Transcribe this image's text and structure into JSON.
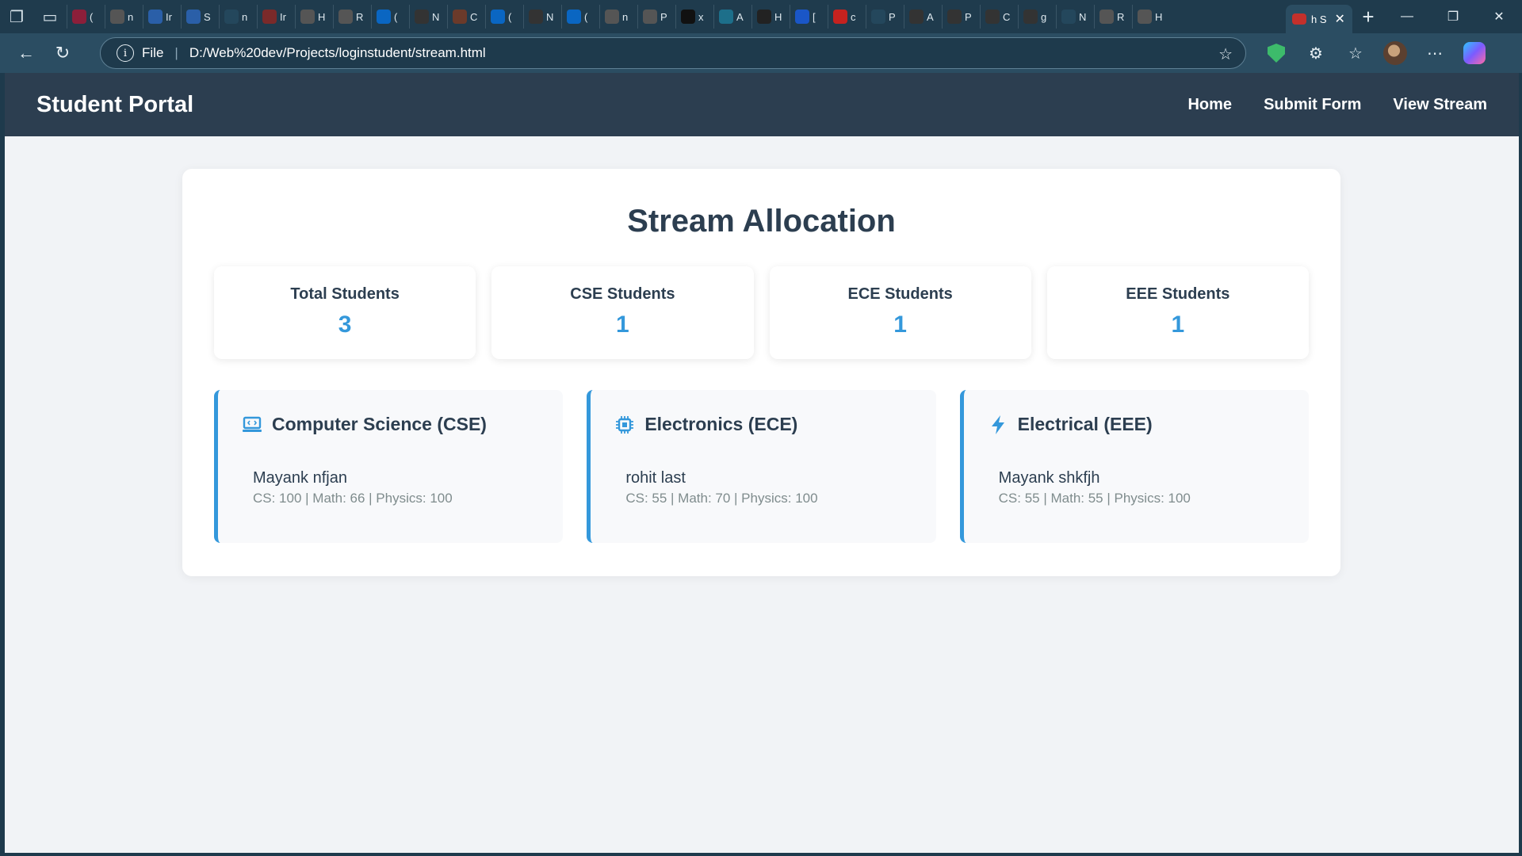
{
  "browser": {
    "url_scheme": "File",
    "url": "D:/Web%20dev/Projects/loginstudent/stream.html",
    "tab_letters": [
      "(",
      "n",
      "Ir",
      "S",
      "n",
      "Ir",
      "H",
      "R",
      "(",
      "N",
      "C",
      "(",
      "N",
      "(",
      "n",
      "P",
      "x",
      "A",
      "H",
      "[",
      "c",
      "P",
      "A",
      "P",
      "C",
      "g",
      "N",
      "R",
      "H"
    ],
    "active_tab_letter": "h S",
    "colors": {
      "tabbar": "#1f3b4d",
      "toolbar": "#2b4d62"
    }
  },
  "site": {
    "brand": "Student Portal",
    "nav": [
      "Home",
      "Submit Form",
      "View Stream"
    ]
  },
  "page": {
    "title": "Stream Allocation",
    "stats": [
      {
        "label": "Total Students",
        "value": "3"
      },
      {
        "label": "CSE Students",
        "value": "1"
      },
      {
        "label": "ECE Students",
        "value": "1"
      },
      {
        "label": "EEE Students",
        "value": "1"
      }
    ],
    "streams": [
      {
        "icon": "laptop-icon",
        "title": "Computer Science (CSE)",
        "student": "Mayank nfjan",
        "marks": "CS: 100 | Math: 66 | Physics: 100"
      },
      {
        "icon": "chip-icon",
        "title": "Electronics (ECE)",
        "student": "rohit last",
        "marks": "CS: 55 | Math: 70 | Physics: 100"
      },
      {
        "icon": "bolt-icon",
        "title": "Electrical (EEE)",
        "student": "Mayank shkfjh",
        "marks": "CS: 55 | Math: 55 | Physics: 100"
      }
    ],
    "accent": "#3498db",
    "navbar_color": "#2c3e50"
  }
}
